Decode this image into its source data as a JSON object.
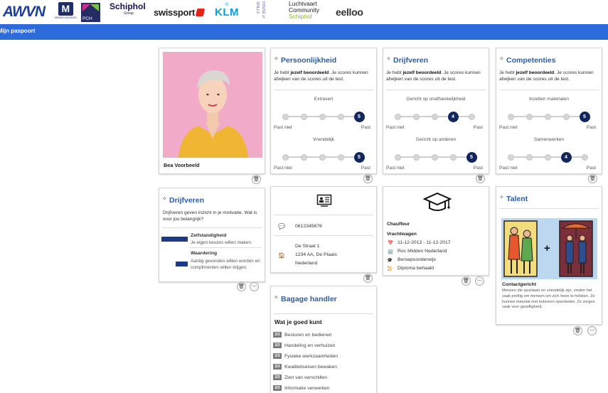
{
  "logos": {
    "awvn": "AWVN",
    "mendes": "M",
    "mendes_sub": "MENDES AVIATION",
    "pch": "PCH",
    "schiphol": "Schiphol",
    "schiphol_sub": "Group",
    "swissport": "swissport",
    "klm": "KLM",
    "house_of_skills": "HOUSE of SKILLS",
    "lc_line1": "Luchtvaart",
    "lc_line2": "Community",
    "lc_line3": "Schiphol",
    "eelloo": "eelloo"
  },
  "nav": {
    "title": "Mijn paspoort"
  },
  "profile": {
    "name": "Bea Voorbeeld"
  },
  "persoonlijkheid": {
    "title": "Persoonlijkheid",
    "desc_pre": "Je hebt ",
    "desc_bold": "jezelf beoordeeld",
    "desc_post": ". Je scores kunnen afwijken van de scores uit de test.",
    "scales": [
      {
        "label": "Extravert",
        "value": 5,
        "left": "Past niet",
        "right": "Past"
      },
      {
        "label": "Vriendelijk",
        "value": 5,
        "left": "Past niet",
        "right": "Past"
      }
    ]
  },
  "drijfveren_scale": {
    "title": "Drijfveren",
    "desc_pre": "Je hebt ",
    "desc_bold": "jezelf beoordeeld",
    "desc_post": ". Je scores kunnen afwijken van de scores uit de test.",
    "scales": [
      {
        "label": "Gericht op onafhankelijkheid",
        "value": 4,
        "left": "Past niet",
        "right": "Past"
      },
      {
        "label": "Gericht op anderen",
        "value": 5,
        "left": "Past niet",
        "right": "Past"
      }
    ]
  },
  "competenties": {
    "title": "Competenties",
    "desc_pre": "Je hebt ",
    "desc_bold": "jezelf beoordeeld",
    "desc_post": ". Je scores kunnen afwijken van de scores uit de test.",
    "scales": [
      {
        "label": "Inzetten materialen",
        "value": 5,
        "left": "Past niet",
        "right": "Past"
      },
      {
        "label": "Samenwerken",
        "value": 4,
        "left": "Past niet",
        "right": "Past"
      }
    ]
  },
  "drijfveren_info": {
    "title": "Drijfveren",
    "desc": "Drijfveren geven inzicht in je motivatie. Wat is voor jou belangrijk?",
    "items": [
      {
        "name": "Zelfstandigheid",
        "desc": "Je eigen keuzes willen maken.",
        "level": 1.0
      },
      {
        "name": "Waardering",
        "desc": "Aardig gevonden willen worden en complimenten willen krijgen.",
        "level": 0.45
      }
    ]
  },
  "contact": {
    "phone": "0612345678",
    "street": "De Straat 1",
    "city": "1234 AA, De Plaats",
    "country": "Nederland"
  },
  "education": {
    "role": "Chauffeur",
    "course": "Vrachtwagen",
    "period": "11-12-2013 - 11-12-2017",
    "school": "Roc Midden Nederland",
    "level": "Beroepsonderwijs",
    "status": "Diploma behaald"
  },
  "talent": {
    "title": "Talent",
    "plus": "+",
    "name": "Contactgericht",
    "desc": "Mensen die spontaan en vriendelijk zijn, vinden het vaak prettig om mensen om zich heen te hebben. Ze kunnen meestal met iedereen opschieten. Ze zorgen vaak voor gezelligheid."
  },
  "bagage": {
    "title": "Bagage handler",
    "subtitle": "Wat je goed kunt",
    "items": [
      {
        "badge": "2/3",
        "label": "Besturen en bedienen"
      },
      {
        "badge": "2/3",
        "label": "Handeling en verhuizen"
      },
      {
        "badge": "2/3",
        "label": "Fysieke werkzaamheden"
      },
      {
        "badge": "2/3",
        "label": "Kwaliteitseisen bewaken"
      },
      {
        "badge": "2/3",
        "label": "Zien van verschillen"
      },
      {
        "badge": "2/3",
        "label": "Informatie verwerken"
      }
    ]
  },
  "icons": {
    "trash": "trash-icon",
    "more": "more-icon"
  },
  "colors": {
    "brand_blue": "#2d6bdc",
    "title_blue": "#2a5caa",
    "dark_navy": "#10265c"
  }
}
